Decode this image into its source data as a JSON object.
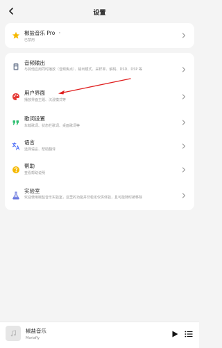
{
  "header": {
    "title": "设置"
  },
  "pro": {
    "title": "椒盐音乐 Pro",
    "dot": "·",
    "subtitle": "已禁用"
  },
  "settings": [
    {
      "id": "audio-output",
      "title": "音频输出",
      "subtitle": "与其他应用同时播放（音频焦点）、输出模式、采样率、解码、DSD、DSP 等",
      "icon": "speaker-icon"
    },
    {
      "id": "user-interface",
      "title": "用户界面",
      "subtitle": "播放界面主题、沉浸模式等",
      "icon": "palette-icon"
    },
    {
      "id": "lyrics",
      "title": "歌词设置",
      "subtitle": "车载歌词、状态栏歌词、桌面歌词等",
      "icon": "quote-icon"
    },
    {
      "id": "language",
      "title": "语言",
      "subtitle": "选择语言、帮助翻译",
      "icon": "translate-icon"
    },
    {
      "id": "help",
      "title": "帮助",
      "subtitle": "查看帮助说明",
      "icon": "help-icon"
    },
    {
      "id": "lab",
      "title": "实验室",
      "subtitle": "欢迎使用椒盐音乐实验室，这里的功能并非稳定仅供体验，且可能随时被移除",
      "icon": "flask-icon"
    }
  ],
  "player": {
    "title": "椒盐音乐",
    "artist": "Moriafly"
  },
  "colors": {
    "accent": "#2d8cf0",
    "star": "#f5b800",
    "palette": "#e53935",
    "quote": "#2fbf71",
    "translate": "#4a6cf7",
    "help": "#f5b800",
    "flask": "#6c7ae0",
    "arrow": "#e02020"
  }
}
